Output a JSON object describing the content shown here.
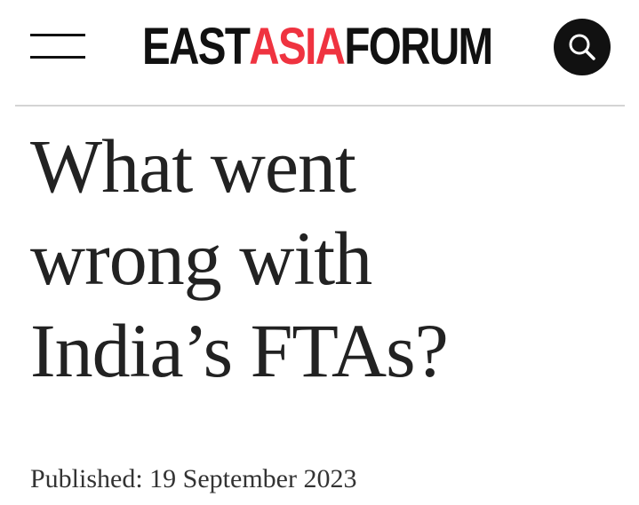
{
  "header": {
    "logo": {
      "part1": "EAST",
      "part2": "ASIA",
      "part3": "FORUM"
    },
    "menu_icon": "hamburger-menu-icon",
    "search_icon": "search-icon",
    "accent_color": "#ef3340"
  },
  "article": {
    "title_lines": [
      "What went",
      "wrong with",
      "India’s FTAs?"
    ],
    "published": "Published: 19 September 2023"
  }
}
